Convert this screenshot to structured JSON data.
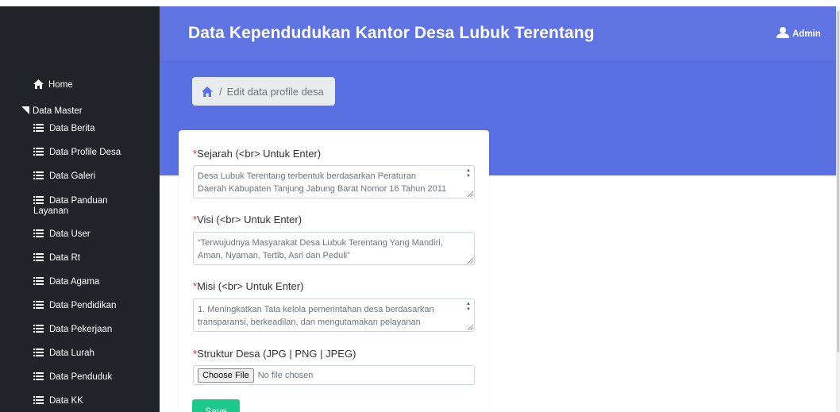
{
  "header": {
    "title": "Data Kependudukan Kantor Desa Lubuk Terentang",
    "user_label": "Admin",
    "colors": {
      "primary": "#5f73e3",
      "sidebar": "#212529",
      "save": "#1cc88a"
    }
  },
  "sidebar": {
    "home_label": "Home",
    "master_label": "Data Master",
    "items": [
      {
        "label": "Data Berita",
        "icon": "list-icon"
      },
      {
        "label": "Data Profile Desa",
        "icon": "list-icon"
      },
      {
        "label": "Data Galeri",
        "icon": "list-icon"
      },
      {
        "label": "Data Panduan Layanan",
        "icon": "list-icon"
      },
      {
        "label": "Data User",
        "icon": "list-icon"
      },
      {
        "label": "Data Rt",
        "icon": "list-icon"
      },
      {
        "label": "Data Agama",
        "icon": "list-icon"
      },
      {
        "label": "Data Pendidikan",
        "icon": "list-icon"
      },
      {
        "label": "Data Pekerjaan",
        "icon": "list-icon"
      },
      {
        "label": "Data Lurah",
        "icon": "list-icon"
      },
      {
        "label": "Data Penduduk",
        "icon": "list-icon"
      },
      {
        "label": "Data KK",
        "icon": "list-icon"
      }
    ]
  },
  "breadcrumb": {
    "separator": "/",
    "current": "Edit data profile desa",
    "icon": "home-icon"
  },
  "form": {
    "sejarah": {
      "required_mark": "*",
      "label": "Sejarah (<br> Untuk Enter)",
      "value": "Desa Lubuk Terentang  terbentuk berdasarkan Peraturan\nDaerah Kabupaten Tanjung Jabung Barat Nomor 16 Tahun 2011"
    },
    "visi": {
      "required_mark": "*",
      "label": "Visi (<br> Untuk Enter)",
      "value": "“Terwujudnya Masyarakat Desa Lubuk Terentang Yang Mandiri,\nAman, Nyaman, Tertib, Asri dan Peduli”"
    },
    "misi": {
      "required_mark": "*",
      "label": "Misi (<br> Untuk Enter)",
      "value": "1.    Meningkatkan Tata kelola pemerintahan desa berdasarkan\ntransparansi, berkeadilan, dan mengutamakan pelayanan"
    },
    "struktur": {
      "required_mark": "*",
      "label": "Struktur Desa (JPG | PNG | JPEG)",
      "choose_button": "Choose File",
      "file_status": "No file chosen"
    },
    "save_label": "Save"
  }
}
